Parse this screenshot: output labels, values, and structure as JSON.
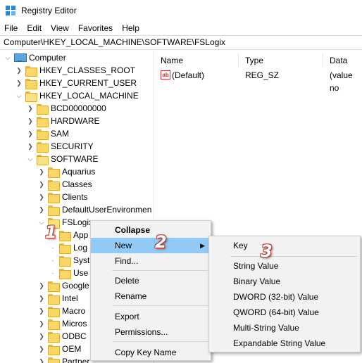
{
  "window": {
    "title": "Registry Editor"
  },
  "menu": [
    "File",
    "Edit",
    "View",
    "Favorites",
    "Help"
  ],
  "address": "Computer\\HKEY_LOCAL_MACHINE\\SOFTWARE\\FSLogix",
  "tree": {
    "root": "Computer",
    "hives": [
      "HKEY_CLASSES_ROOT",
      "HKEY_CURRENT_USER",
      "HKEY_LOCAL_MACHINE"
    ],
    "hklm_children": [
      "BCD00000000",
      "HARDWARE",
      "SAM",
      "SECURITY",
      "SOFTWARE"
    ],
    "software_children": [
      "Aquarius",
      "Classes",
      "Clients",
      "DefaultUserEnvironmen",
      "FSLogix"
    ],
    "fslogix_children": [
      "App",
      "Log",
      "Syst",
      "Use"
    ],
    "more_software": [
      "Google",
      "Intel",
      "Macro",
      "Micros",
      "ODBC",
      "OEM",
      "Partner"
    ]
  },
  "list": {
    "columns": [
      "Name",
      "Type",
      "Data"
    ],
    "rows": [
      {
        "name": "(Default)",
        "type": "REG_SZ",
        "data": "(value no"
      }
    ]
  },
  "context_menu": {
    "items": [
      "Collapse",
      "New",
      "Find...",
      "Delete",
      "Rename",
      "Export",
      "Permissions...",
      "Copy Key Name"
    ]
  },
  "new_submenu": {
    "items": [
      "Key",
      "String Value",
      "Binary Value",
      "DWORD (32-bit) Value",
      "QWORD (64-bit) Value",
      "Multi-String Value",
      "Expandable String Value"
    ]
  },
  "callouts": [
    "1",
    "2",
    "3"
  ],
  "colors": {
    "highlight": "#91c9f7",
    "callout_outline": "#c0392b"
  }
}
